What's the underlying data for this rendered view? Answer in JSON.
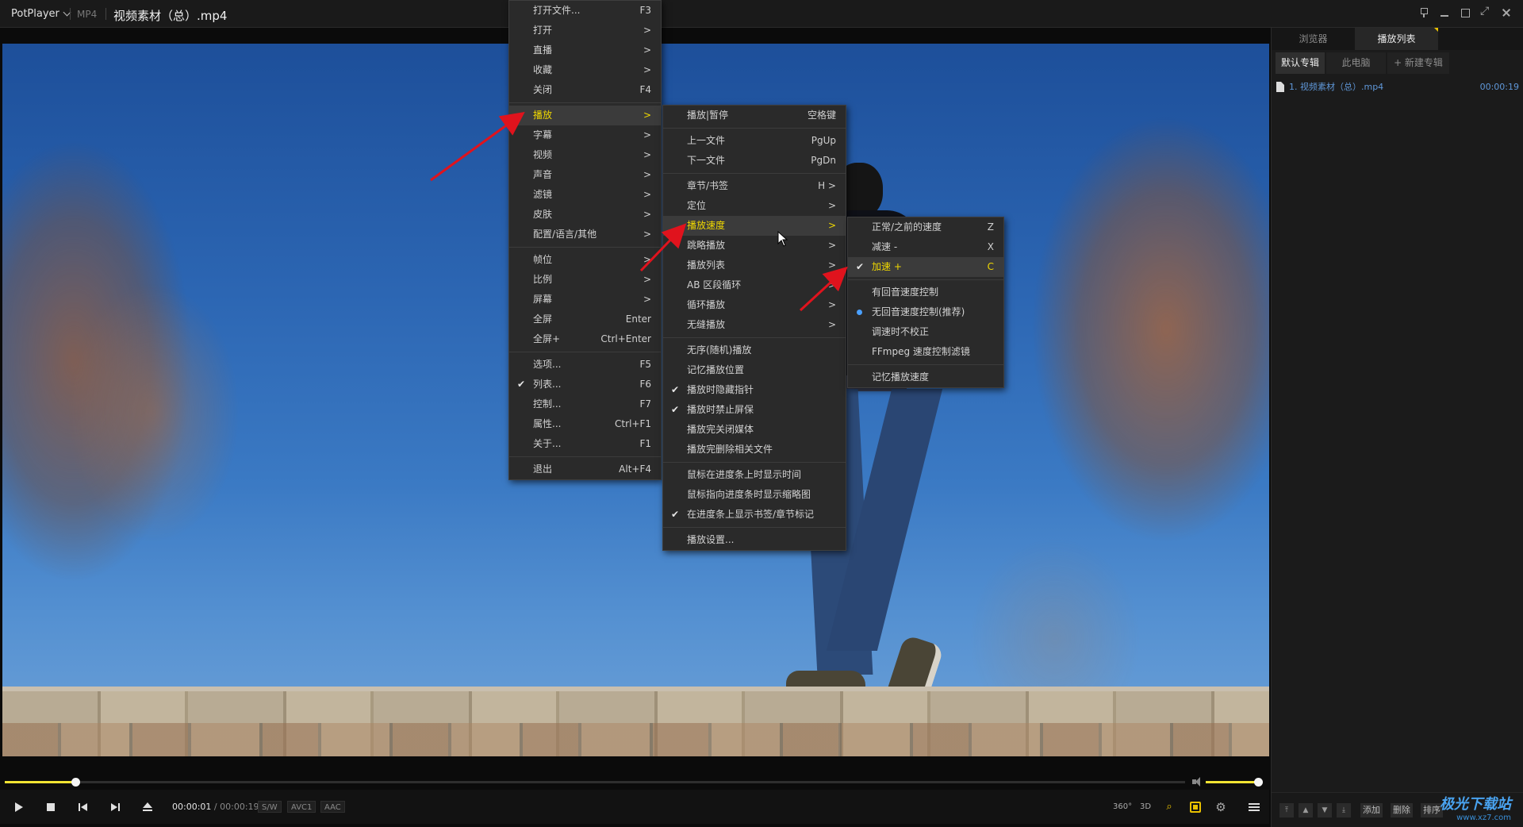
{
  "titlebar": {
    "app_name": "PotPlayer",
    "format": "MP4",
    "title": "视频素材（总）.mp4"
  },
  "main_menu": [
    {
      "label": "打开文件...",
      "shortcut": "F3"
    },
    {
      "label": "打开",
      "shortcut": ">"
    },
    {
      "label": "直播",
      "shortcut": ">"
    },
    {
      "label": "收藏",
      "shortcut": ">"
    },
    {
      "label": "关闭",
      "shortcut": "F4"
    },
    {
      "label": "播放",
      "shortcut": ">",
      "active": true
    },
    {
      "label": "字幕",
      "shortcut": ">"
    },
    {
      "label": "视频",
      "shortcut": ">"
    },
    {
      "label": "声音",
      "shortcut": ">"
    },
    {
      "label": "滤镜",
      "shortcut": ">"
    },
    {
      "label": "皮肤",
      "shortcut": ">"
    },
    {
      "label": "配置/语言/其他",
      "shortcut": ">"
    },
    {
      "label": "帧位",
      "shortcut": ">"
    },
    {
      "label": "比例",
      "shortcut": ">"
    },
    {
      "label": "屏幕",
      "shortcut": ">"
    },
    {
      "label": "全屏",
      "shortcut": "Enter"
    },
    {
      "label": "全屏+",
      "shortcut": "Ctrl+Enter"
    },
    {
      "label": "选项...",
      "shortcut": "F5"
    },
    {
      "label": "列表...",
      "shortcut": "F6",
      "checked": true
    },
    {
      "label": "控制...",
      "shortcut": "F7"
    },
    {
      "label": "属性...",
      "shortcut": "Ctrl+F1"
    },
    {
      "label": "关于...",
      "shortcut": "F1"
    },
    {
      "label": "退出",
      "shortcut": "Alt+F4"
    }
  ],
  "play_menu": [
    {
      "label": "播放|暂停",
      "shortcut": "空格键"
    },
    {
      "label": "上一文件",
      "shortcut": "PgUp"
    },
    {
      "label": "下一文件",
      "shortcut": "PgDn"
    },
    {
      "label": "章节/书签",
      "shortcut": "H >"
    },
    {
      "label": "定位",
      "shortcut": ">"
    },
    {
      "label": "播放速度",
      "shortcut": ">",
      "active": true
    },
    {
      "label": "跳略播放",
      "shortcut": ">"
    },
    {
      "label": "播放列表",
      "shortcut": ">"
    },
    {
      "label": "AB 区段循环",
      "shortcut": ">"
    },
    {
      "label": "循环播放",
      "shortcut": ">"
    },
    {
      "label": "无缝播放",
      "shortcut": ">"
    },
    {
      "label": "无序(随机)播放",
      "shortcut": ""
    },
    {
      "label": "记忆播放位置",
      "shortcut": ""
    },
    {
      "label": "播放时隐藏指针",
      "shortcut": "",
      "checked": true
    },
    {
      "label": "播放时禁止屏保",
      "shortcut": "",
      "checked": true
    },
    {
      "label": "播放完关闭媒体",
      "shortcut": ""
    },
    {
      "label": "播放完删除相关文件",
      "shortcut": ""
    },
    {
      "label": "鼠标在进度条上时显示时间",
      "shortcut": ""
    },
    {
      "label": "鼠标指向进度条时显示缩略图",
      "shortcut": ""
    },
    {
      "label": "在进度条上显示书签/章节标记",
      "shortcut": "",
      "checked": true
    },
    {
      "label": "播放设置...",
      "shortcut": ""
    }
  ],
  "speed_menu": [
    {
      "label": "正常/之前的速度",
      "shortcut": "Z"
    },
    {
      "label": "减速 -",
      "shortcut": "X"
    },
    {
      "label": "加速 +",
      "shortcut": "C",
      "checked": true,
      "active": true
    },
    {
      "label": "有回音速度控制",
      "shortcut": ""
    },
    {
      "label": "无回音速度控制(推荐)",
      "shortcut": "",
      "radio": true
    },
    {
      "label": "调速时不校正",
      "shortcut": ""
    },
    {
      "label": "FFmpeg 速度控制滤镜",
      "shortcut": ""
    },
    {
      "label": "记忆播放速度",
      "shortcut": ""
    }
  ],
  "controls": {
    "current_time": "00:00:01",
    "divider": "/",
    "duration": "00:00:19",
    "tags": [
      "S/W",
      "AVC1",
      "AAC"
    ],
    "btn_360": "360°",
    "btn_3d": "3D",
    "progress_fraction": 0.06,
    "volume_fraction": 1.0
  },
  "panel": {
    "tab_browser": "浏览器",
    "tab_playlist": "播放列表",
    "sub_default": "默认专辑",
    "sub_pc": "此电脑",
    "sub_new": "+ 新建专辑",
    "items": [
      {
        "name": "1. 视频素材（总）.mp4",
        "duration": "00:00:19"
      }
    ],
    "btn_add": "添加",
    "btn_delete": "删除",
    "btn_sort": "排序"
  },
  "watermark": {
    "line1": "极光下载站",
    "line2": "www.xz7.com"
  },
  "colors": {
    "accent": "#f0d800",
    "arrow": "#e0131d",
    "link": "#5f97d8"
  }
}
